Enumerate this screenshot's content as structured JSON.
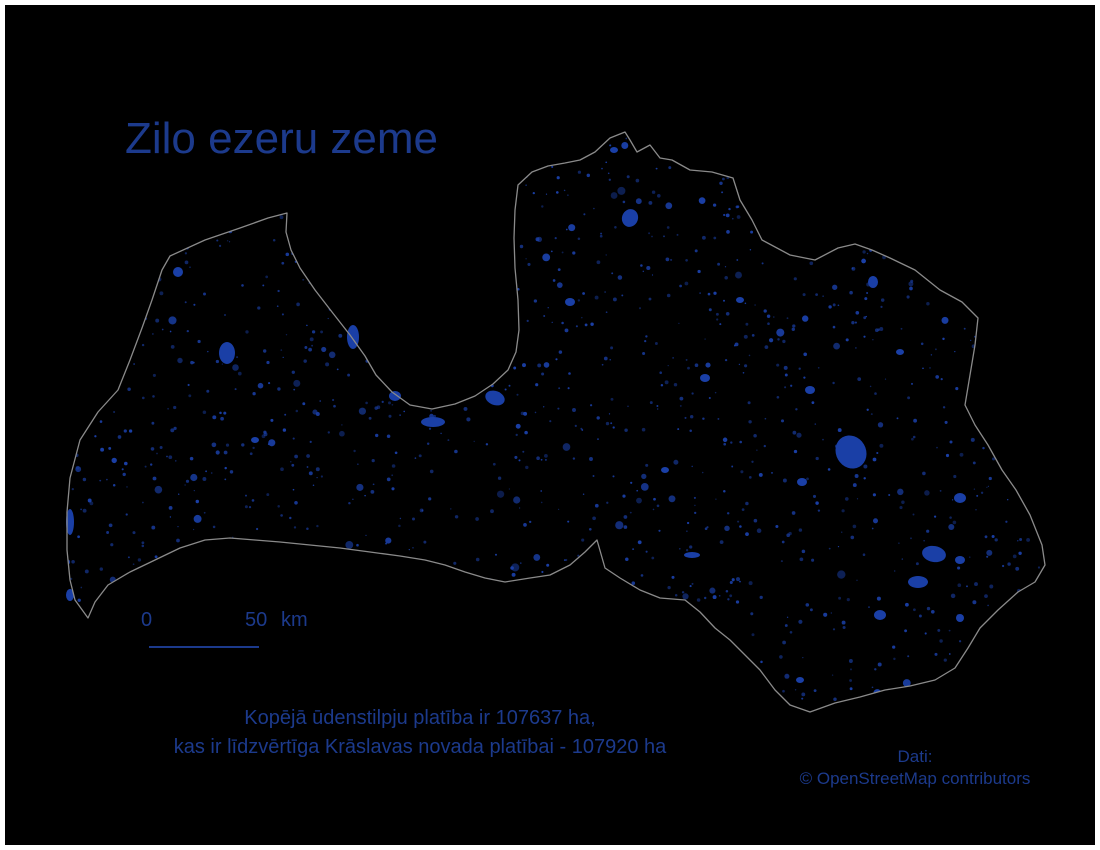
{
  "map": {
    "title": "Zilo ezeru zeme",
    "scale": {
      "start_label": "0",
      "end_label": "50",
      "unit": "km"
    },
    "summary": {
      "line1": "Kopējā ūdenstilpju platība ir 107637 ha,",
      "line2": "kas ir līdzvērtīga Krāslavas novada platībai - 107920 ha"
    },
    "credits": {
      "label": "Dati:",
      "source": "© OpenStreetMap contributors"
    }
  },
  "style": {
    "background": "#000000",
    "text_color": "#1c3a8c",
    "water_color": "#1a3fa6",
    "border_color": "#8a8a8a"
  }
}
